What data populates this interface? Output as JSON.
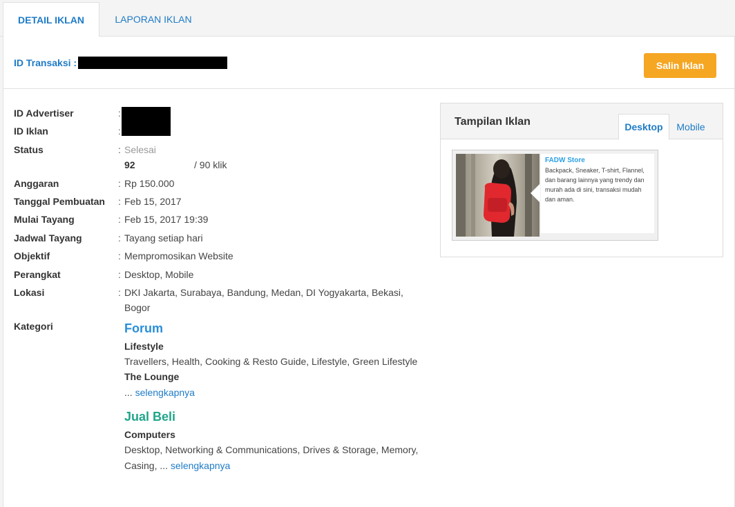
{
  "tabs": {
    "detail": "DETAIL IKLAN",
    "report": "LAPORAN IKLAN"
  },
  "header": {
    "transaction_label": "ID Transaksi :",
    "copy_button": "Salin Iklan"
  },
  "details": {
    "advertiser_label": "ID Advertiser",
    "ad_id_label": "ID Iklan",
    "status_label": "Status",
    "status_value": "Selesai",
    "clicks_done": "92",
    "clicks_total": "/ 90 klik",
    "budget_label": "Anggaran",
    "budget_value": "Rp 150.000",
    "created_label": "Tanggal Pembuatan",
    "created_value": "Feb 15, 2017",
    "start_label": "Mulai Tayang",
    "start_value": "Feb 15, 2017 19:39",
    "schedule_label": "Jadwal Tayang",
    "schedule_value": "Tayang setiap hari",
    "objective_label": "Objektif",
    "objective_value": "Mempromosikan Website",
    "device_label": "Perangkat",
    "device_value": "Desktop, Mobile",
    "location_label": "Lokasi",
    "location_line1": "DKI Jakarta, Surabaya, Bandung, Medan, DI Yogyakarta, Bekasi,",
    "location_line2": "Bogor",
    "category_label": "Kategori",
    "colon": ":"
  },
  "categories": {
    "forum_title": "Forum",
    "forum_sub1": "Lifestyle",
    "forum_sub1_items": "Travellers, Health, Cooking & Resto Guide, Lifestyle, Green Lifestyle",
    "forum_sub2": "The Lounge",
    "forum_more_prefix": "...",
    "more_link": "selengkapnya",
    "jual_title": "Jual Beli",
    "jual_sub1": "Computers",
    "jual_items_line1": "Desktop, Networking & Communications, Drives & Storage, Memory,",
    "jual_items_line2": "Casing, ..."
  },
  "preview": {
    "title": "Tampilan Iklan",
    "tab_desktop": "Desktop",
    "tab_mobile": "Mobile",
    "ad_name": "FADW Store",
    "ad_desc": "Backpack, Sneaker, T-shirt, Flannel, dan barang lainnya yang trendy dan murah ada di sini, transaksi mudah dan aman."
  },
  "colors": {
    "link": "#1e7bc6",
    "button": "#f5a623",
    "forum": "#2a8ed9",
    "jual_beli": "#1fa58a",
    "ad_name": "#2aa0e6"
  }
}
